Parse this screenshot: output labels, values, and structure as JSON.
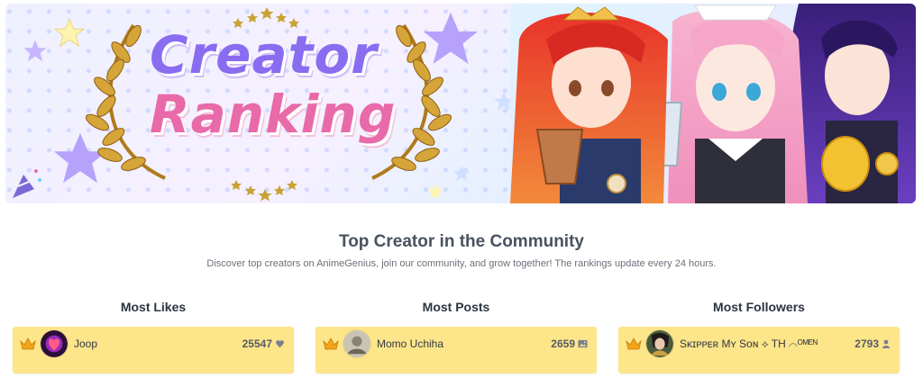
{
  "banner": {
    "title_line1": "Creator",
    "title_line2": "Ranking"
  },
  "header": {
    "title": "Top Creator in the Community",
    "subtitle": "Discover top creators on AnimeGenius, join our community, and grow together! The rankings update every 24 hours."
  },
  "columns": [
    {
      "title": "Most Likes",
      "user": "Joop",
      "value": "25547",
      "metric_icon": "heart-icon"
    },
    {
      "title": "Most Posts",
      "user": "Momo Uchiha",
      "value": "2659",
      "metric_icon": "image-icon"
    },
    {
      "title": "Most Followers",
      "user": "Sᴋɪᴘᴘᴇʀ Mʏ Sᴏɴ ⟡ TH ⌒ᴼᴹᴱᴺ",
      "value": "2793",
      "metric_icon": "person-icon"
    }
  ],
  "colors": {
    "card_bg": "#fde58a",
    "title_purple": "#8a6cf0",
    "title_pink": "#e86aa8"
  }
}
